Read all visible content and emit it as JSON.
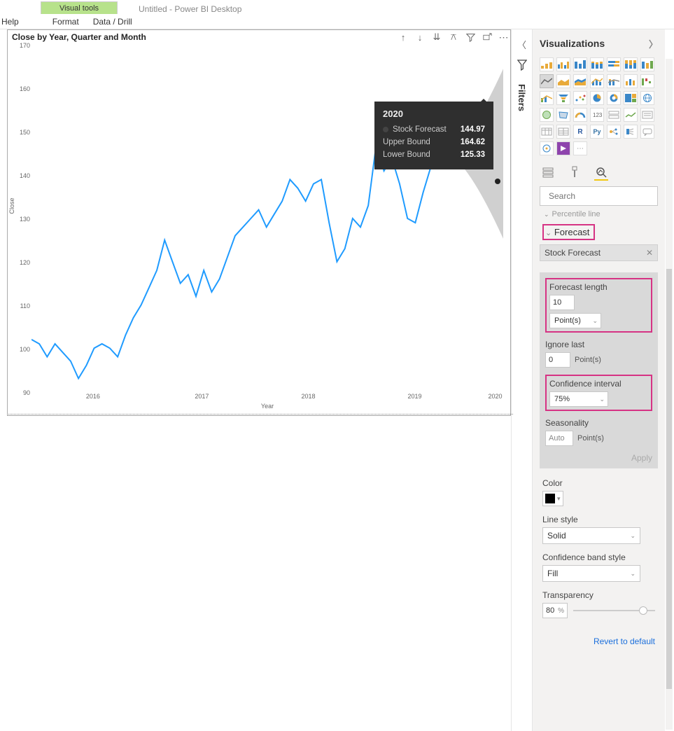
{
  "app": {
    "title": "Untitled - Power BI Desktop",
    "visual_tools_tab": "Visual tools",
    "menu": {
      "help": "Help",
      "format": "Format",
      "data_drill": "Data / Drill"
    }
  },
  "chart_data": {
    "type": "line",
    "title": "Close by Year, Quarter and Month",
    "xlabel": "Year",
    "ylabel": "Close",
    "ylim": [
      90,
      170
    ],
    "yticks": [
      90,
      100,
      110,
      120,
      130,
      140,
      150,
      160,
      170
    ],
    "xticks": [
      "2016",
      "2017",
      "2018",
      "2019",
      "2020"
    ],
    "x": [
      "2015-07",
      "2015-08",
      "2015-09",
      "2015-10",
      "2015-11",
      "2015-12",
      "2016-01",
      "2016-02",
      "2016-03",
      "2016-04",
      "2016-05",
      "2016-06",
      "2016-07",
      "2016-08",
      "2016-09",
      "2016-10",
      "2016-11",
      "2016-12",
      "2017-01",
      "2017-02",
      "2017-03",
      "2017-04",
      "2017-05",
      "2017-06",
      "2017-07",
      "2017-08",
      "2017-09",
      "2017-10",
      "2017-11",
      "2017-12",
      "2018-01",
      "2018-02",
      "2018-03",
      "2018-04",
      "2018-05",
      "2018-06",
      "2018-07",
      "2018-08",
      "2018-09",
      "2018-10",
      "2018-11",
      "2018-12",
      "2019-01",
      "2019-02",
      "2019-03",
      "2019-04",
      "2019-05",
      "2019-06",
      "2019-07",
      "2019-08",
      "2019-09",
      "2019-10",
      "2019-11",
      "2019-12"
    ],
    "series": [
      {
        "name": "Close",
        "values": [
          102,
          101,
          98,
          101,
          99,
          97,
          93,
          96,
          100,
          101,
          100,
          98,
          103,
          107,
          110,
          114,
          118,
          125,
          120,
          115,
          117,
          112,
          118,
          113,
          116,
          121,
          126,
          128,
          130,
          132,
          128,
          131,
          134,
          139,
          137,
          134,
          138,
          139,
          129,
          120,
          123,
          130,
          128,
          133,
          147,
          141,
          144,
          138,
          130,
          129,
          136,
          142,
          145,
          145
        ]
      }
    ],
    "forecast": {
      "length_points": 10,
      "last_point": {
        "x": "2020",
        "stock_forecast": 144.97,
        "upper_bound": 164.62,
        "lower_bound": 125.33
      }
    }
  },
  "tooltip": {
    "year": "2020",
    "rows": [
      {
        "label": "Stock Forecast",
        "value": "144.97"
      },
      {
        "label": "Upper Bound",
        "value": "164.62"
      },
      {
        "label": "Lower Bound",
        "value": "125.33"
      }
    ]
  },
  "filters_pane": {
    "label": "Filters"
  },
  "viz_pane": {
    "header": "Visualizations",
    "search_placeholder": "Search",
    "truncated_item": "Percentile line",
    "section": "Forecast",
    "series_name": "Stock Forecast",
    "forecast_length": {
      "label": "Forecast length",
      "value": "10",
      "unit": "Point(s)"
    },
    "ignore_last": {
      "label": "Ignore last",
      "value": "0",
      "unit": "Point(s)"
    },
    "confidence": {
      "label": "Confidence interval",
      "value": "75%"
    },
    "seasonality": {
      "label": "Seasonality",
      "value": "Auto",
      "unit": "Point(s)"
    },
    "apply": "Apply",
    "color": {
      "label": "Color",
      "value": "#000000"
    },
    "line_style": {
      "label": "Line style",
      "value": "Solid"
    },
    "conf_band": {
      "label": "Confidence band style",
      "value": "Fill"
    },
    "transparency": {
      "label": "Transparency",
      "value": "80",
      "unit": "%",
      "slider_pct": 80
    },
    "revert": "Revert to default"
  }
}
